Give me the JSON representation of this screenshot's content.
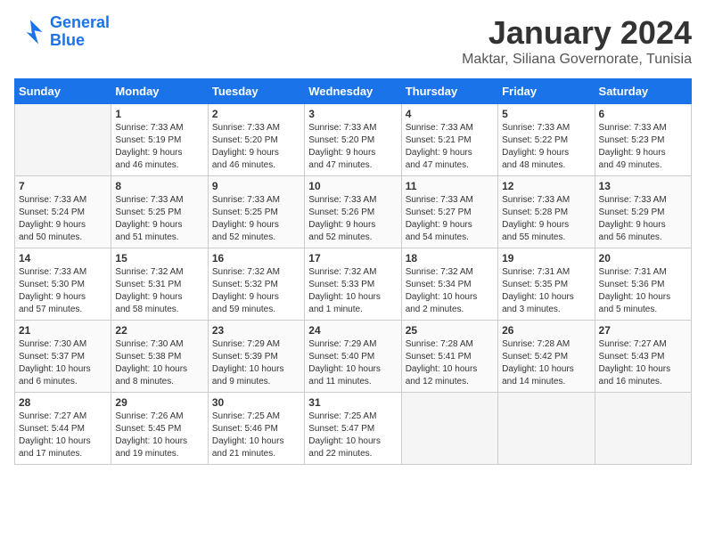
{
  "header": {
    "logo_line1": "General",
    "logo_line2": "Blue",
    "month_title": "January 2024",
    "location": "Maktar, Siliana Governorate, Tunisia"
  },
  "weekdays": [
    "Sunday",
    "Monday",
    "Tuesday",
    "Wednesday",
    "Thursday",
    "Friday",
    "Saturday"
  ],
  "weeks": [
    [
      {
        "day": "",
        "info": ""
      },
      {
        "day": "1",
        "info": "Sunrise: 7:33 AM\nSunset: 5:19 PM\nDaylight: 9 hours\nand 46 minutes."
      },
      {
        "day": "2",
        "info": "Sunrise: 7:33 AM\nSunset: 5:20 PM\nDaylight: 9 hours\nand 46 minutes."
      },
      {
        "day": "3",
        "info": "Sunrise: 7:33 AM\nSunset: 5:20 PM\nDaylight: 9 hours\nand 47 minutes."
      },
      {
        "day": "4",
        "info": "Sunrise: 7:33 AM\nSunset: 5:21 PM\nDaylight: 9 hours\nand 47 minutes."
      },
      {
        "day": "5",
        "info": "Sunrise: 7:33 AM\nSunset: 5:22 PM\nDaylight: 9 hours\nand 48 minutes."
      },
      {
        "day": "6",
        "info": "Sunrise: 7:33 AM\nSunset: 5:23 PM\nDaylight: 9 hours\nand 49 minutes."
      }
    ],
    [
      {
        "day": "7",
        "info": "Sunrise: 7:33 AM\nSunset: 5:24 PM\nDaylight: 9 hours\nand 50 minutes."
      },
      {
        "day": "8",
        "info": "Sunrise: 7:33 AM\nSunset: 5:25 PM\nDaylight: 9 hours\nand 51 minutes."
      },
      {
        "day": "9",
        "info": "Sunrise: 7:33 AM\nSunset: 5:25 PM\nDaylight: 9 hours\nand 52 minutes."
      },
      {
        "day": "10",
        "info": "Sunrise: 7:33 AM\nSunset: 5:26 PM\nDaylight: 9 hours\nand 52 minutes."
      },
      {
        "day": "11",
        "info": "Sunrise: 7:33 AM\nSunset: 5:27 PM\nDaylight: 9 hours\nand 54 minutes."
      },
      {
        "day": "12",
        "info": "Sunrise: 7:33 AM\nSunset: 5:28 PM\nDaylight: 9 hours\nand 55 minutes."
      },
      {
        "day": "13",
        "info": "Sunrise: 7:33 AM\nSunset: 5:29 PM\nDaylight: 9 hours\nand 56 minutes."
      }
    ],
    [
      {
        "day": "14",
        "info": "Sunrise: 7:33 AM\nSunset: 5:30 PM\nDaylight: 9 hours\nand 57 minutes."
      },
      {
        "day": "15",
        "info": "Sunrise: 7:32 AM\nSunset: 5:31 PM\nDaylight: 9 hours\nand 58 minutes."
      },
      {
        "day": "16",
        "info": "Sunrise: 7:32 AM\nSunset: 5:32 PM\nDaylight: 9 hours\nand 59 minutes."
      },
      {
        "day": "17",
        "info": "Sunrise: 7:32 AM\nSunset: 5:33 PM\nDaylight: 10 hours\nand 1 minute."
      },
      {
        "day": "18",
        "info": "Sunrise: 7:32 AM\nSunset: 5:34 PM\nDaylight: 10 hours\nand 2 minutes."
      },
      {
        "day": "19",
        "info": "Sunrise: 7:31 AM\nSunset: 5:35 PM\nDaylight: 10 hours\nand 3 minutes."
      },
      {
        "day": "20",
        "info": "Sunrise: 7:31 AM\nSunset: 5:36 PM\nDaylight: 10 hours\nand 5 minutes."
      }
    ],
    [
      {
        "day": "21",
        "info": "Sunrise: 7:30 AM\nSunset: 5:37 PM\nDaylight: 10 hours\nand 6 minutes."
      },
      {
        "day": "22",
        "info": "Sunrise: 7:30 AM\nSunset: 5:38 PM\nDaylight: 10 hours\nand 8 minutes."
      },
      {
        "day": "23",
        "info": "Sunrise: 7:29 AM\nSunset: 5:39 PM\nDaylight: 10 hours\nand 9 minutes."
      },
      {
        "day": "24",
        "info": "Sunrise: 7:29 AM\nSunset: 5:40 PM\nDaylight: 10 hours\nand 11 minutes."
      },
      {
        "day": "25",
        "info": "Sunrise: 7:28 AM\nSunset: 5:41 PM\nDaylight: 10 hours\nand 12 minutes."
      },
      {
        "day": "26",
        "info": "Sunrise: 7:28 AM\nSunset: 5:42 PM\nDaylight: 10 hours\nand 14 minutes."
      },
      {
        "day": "27",
        "info": "Sunrise: 7:27 AM\nSunset: 5:43 PM\nDaylight: 10 hours\nand 16 minutes."
      }
    ],
    [
      {
        "day": "28",
        "info": "Sunrise: 7:27 AM\nSunset: 5:44 PM\nDaylight: 10 hours\nand 17 minutes."
      },
      {
        "day": "29",
        "info": "Sunrise: 7:26 AM\nSunset: 5:45 PM\nDaylight: 10 hours\nand 19 minutes."
      },
      {
        "day": "30",
        "info": "Sunrise: 7:25 AM\nSunset: 5:46 PM\nDaylight: 10 hours\nand 21 minutes."
      },
      {
        "day": "31",
        "info": "Sunrise: 7:25 AM\nSunset: 5:47 PM\nDaylight: 10 hours\nand 22 minutes."
      },
      {
        "day": "",
        "info": ""
      },
      {
        "day": "",
        "info": ""
      },
      {
        "day": "",
        "info": ""
      }
    ]
  ]
}
